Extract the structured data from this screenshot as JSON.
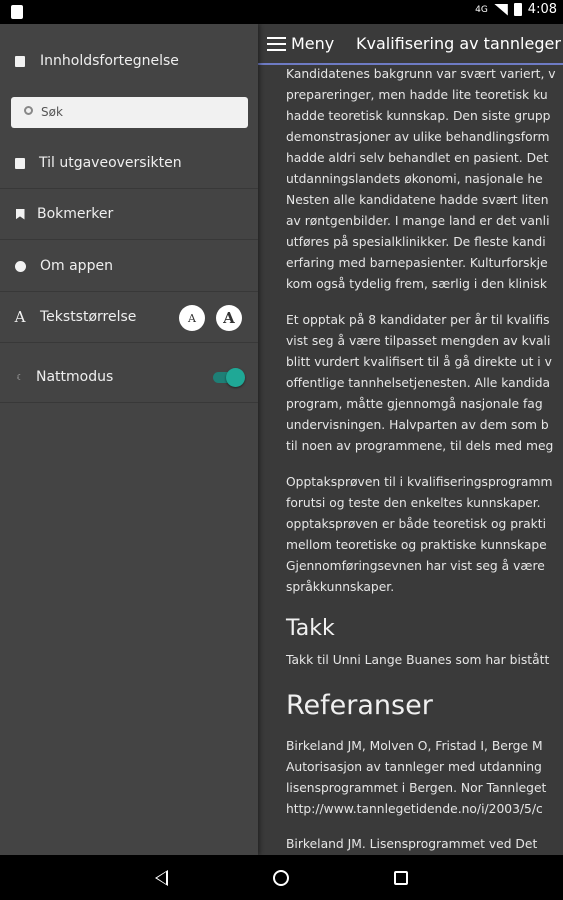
{
  "status_bar": {
    "network": "4G",
    "time": "4:08"
  },
  "sidebar": {
    "toc_label": "Innholdsfortegnelse",
    "search_placeholder": "Søk",
    "issue_overview_label": "Til utgaveoversikten",
    "bookmarks_label": "Bokmerker",
    "about_label": "Om appen",
    "text_size_label": "Tekststørrelse",
    "text_size_small": "A",
    "text_size_large": "A",
    "night_mode_label": "Nattmodus",
    "night_mode_on": true
  },
  "toolbar": {
    "menu_label": "Meny",
    "article_title": "Kvalifisering av tannleger f"
  },
  "article": {
    "para1": [
      "Kandidatenes bakgrunn var svært variert, v",
      "prepareringer, men hadde lite teoretisk ku",
      "hadde teoretisk kunnskap. Den siste grupp",
      "demonstrasjoner av ulike behandlingsform",
      "hadde aldri selv behandlet en pasient. Det",
      "utdanningslandets økonomi, nasjonale he",
      "Nesten alle kandidatene hadde svært liten",
      "av røntgenbilder. I mange land er det vanli",
      "utføres på spesialklinikker. De fleste kandi",
      "erfaring med barnepasienter. Kulturforskje",
      "kom også tydelig frem, særlig i den klinisk"
    ],
    "para2": [
      "Et opptak på 8 kandidater per år til kvalifis",
      "vist seg å være tilpasset mengden av kvali",
      "blitt vurdert kvalifisert til å gå direkte ut i v",
      "offentlige tannhelsetjenesten. Alle kandida",
      "program, måtte gjennomgå nasjonale fag",
      "undervisningen. Halvparten av dem som b",
      "til noen av programmene, til dels med meg"
    ],
    "para3": [
      "Opptaksprøven til i kvalifiseringsprogramm",
      "forutsi og teste den enkeltes kunnskaper.",
      "opptaksprøven er både teoretisk og prakti",
      "mellom teoretiske og praktiske kunnskape",
      "Gjennomføringsevnen har vist seg å være",
      "språkkunnskaper."
    ],
    "heading_takk": "Takk",
    "para_takk": "Takk til Unni Lange Buanes som har bistått",
    "heading_ref": "Referanser",
    "ref1": [
      "Birkeland JM, Molven O, Fristad I, Berge M",
      "Autorisasjon av tannleger med utdanning",
      "lisensprogrammet i Bergen. Nor Tannleget",
      "http://www.tannlegetidende.no/i/2003/5/c"
    ],
    "ref2": "Birkeland JM. Lisensprogrammet ved Det"
  }
}
